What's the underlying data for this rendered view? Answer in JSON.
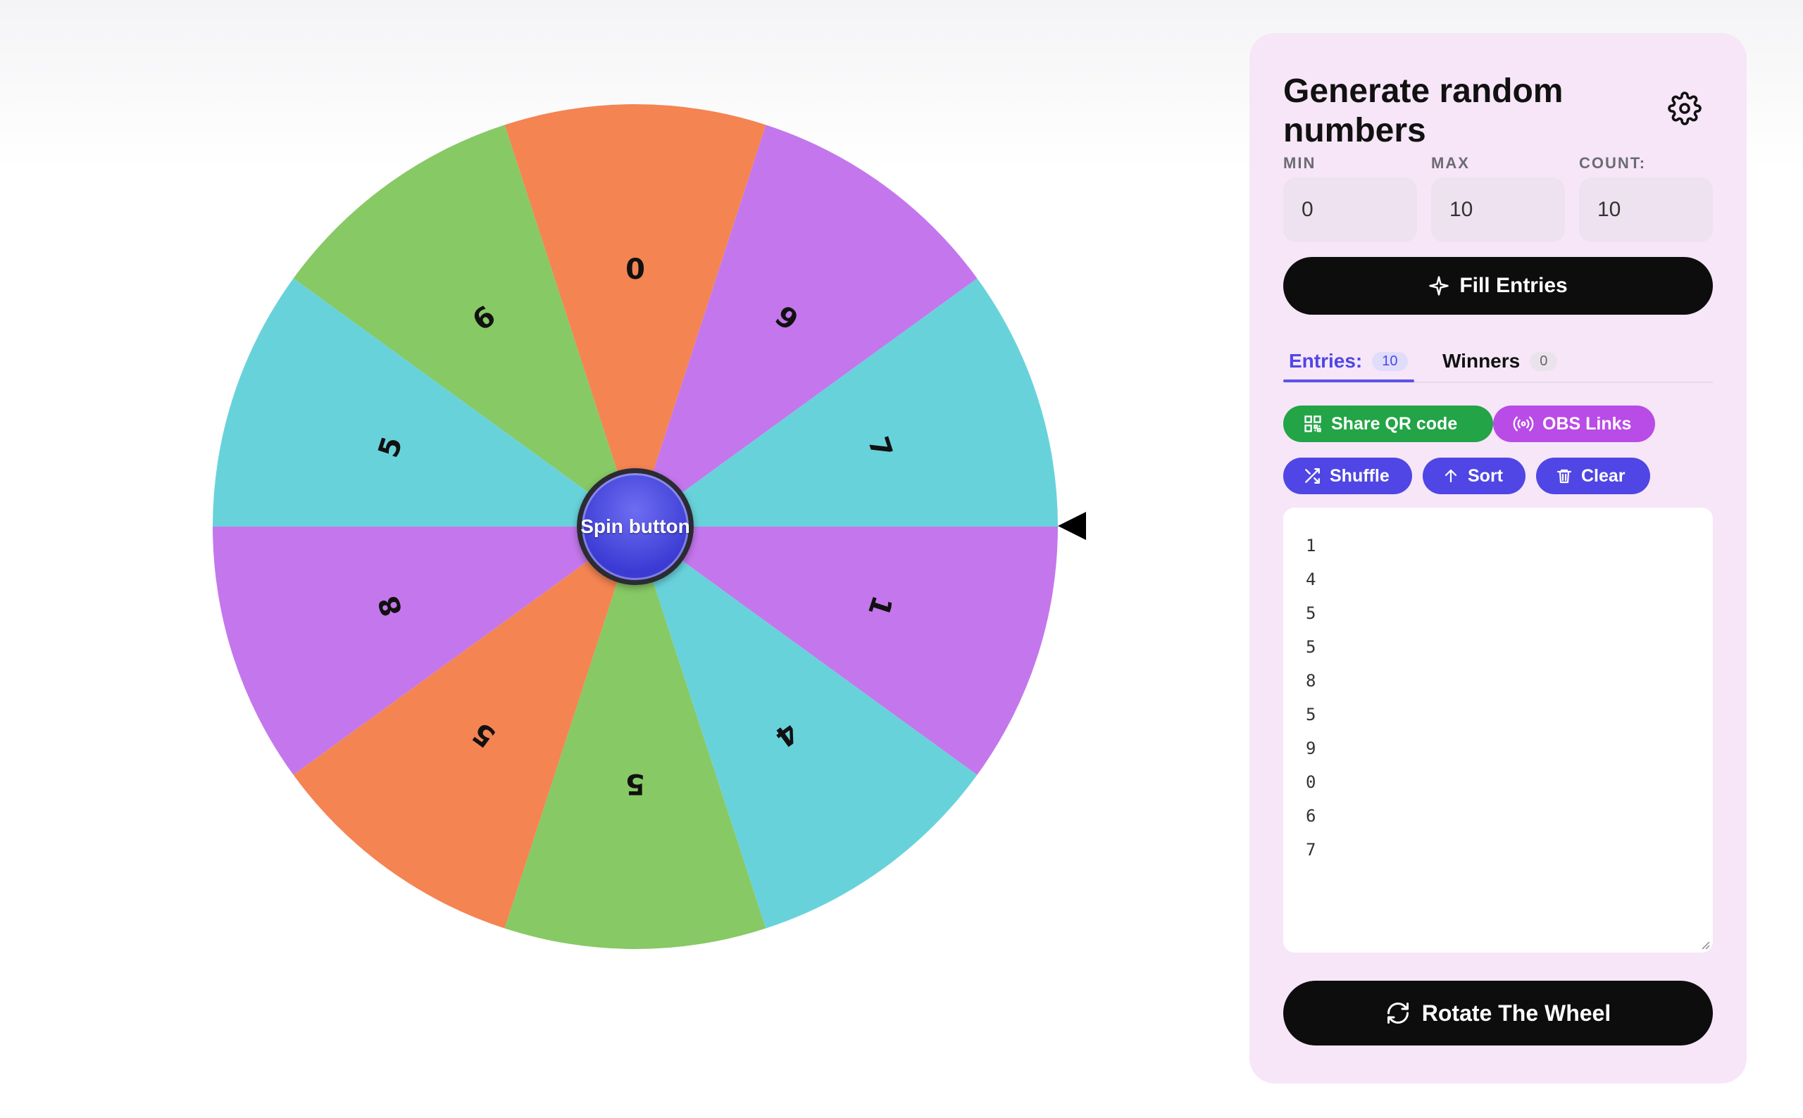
{
  "wheel": {
    "segments": [
      {
        "label": "7",
        "color": "#68d2db"
      },
      {
        "label": "9",
        "color": "#c477ec"
      },
      {
        "label": "0",
        "color": "#f48452"
      },
      {
        "label": "6",
        "color": "#87c965"
      },
      {
        "label": "5",
        "color": "#68d2db"
      },
      {
        "label": "8",
        "color": "#c477ec"
      },
      {
        "label": "5",
        "color": "#f48452"
      },
      {
        "label": "5",
        "color": "#87c965"
      },
      {
        "label": "4",
        "color": "#68d2db"
      },
      {
        "label": "1",
        "color": "#c477ec"
      }
    ],
    "spin_label": "Spin button"
  },
  "panel": {
    "title": "Generate random numbers",
    "icon": "gear-icon",
    "fields": {
      "min_label": "MIN",
      "min_value": "0",
      "max_label": "MAX",
      "max_value": "10",
      "count_label": "COUNT:",
      "count_value": "10"
    },
    "fill_button": "Fill Entries",
    "tabs": {
      "entries_label": "Entries:",
      "entries_count": "10",
      "winners_label": "Winners",
      "winners_count": "0"
    },
    "actions": {
      "share_qr": "Share QR code",
      "obs_links": "OBS Links",
      "shuffle": "Shuffle",
      "sort": "Sort",
      "clear": "Clear"
    },
    "entries": [
      "1",
      "4",
      "5",
      "5",
      "8",
      "5",
      "9",
      "0",
      "6",
      "7"
    ],
    "rotate_button": "Rotate The Wheel"
  },
  "colors": {
    "panel_bg": "#f6e6f7",
    "accent_indigo": "#4f46e5",
    "share_green": "#22a447",
    "obs_purple": "#b94be6",
    "action_indigo": "#4f46e5",
    "dark_button": "#0d0d0d"
  }
}
